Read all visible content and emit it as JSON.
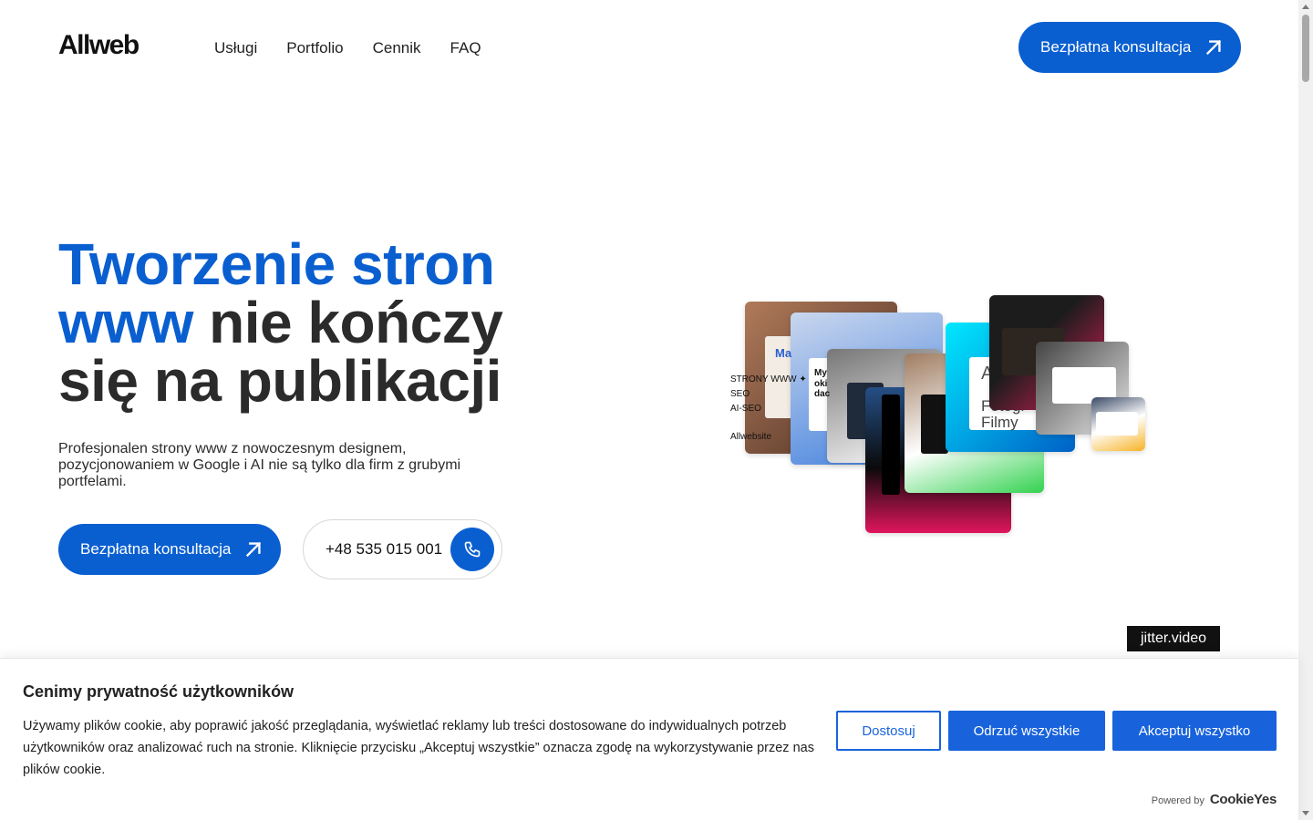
{
  "header": {
    "logo": "Allweb",
    "nav": [
      "Usługi",
      "Portfolio",
      "Cennik",
      "FAQ"
    ],
    "cta_label": "Bezpłatna konsultacja"
  },
  "hero": {
    "title_accent_1": "Tworzenie stron",
    "title_accent_2": "www",
    "title_rest_1": " nie kończy",
    "title_rest_2": "się na publikacji",
    "subtitle": "Profesjonalen strony www z nowoczesnym designem, pozycjonowaniem w Google i AI nie są tylko dla firm z grubymi portfelami.",
    "cta_label": "Bezpłatna konsultacja",
    "phone": "+48 535 015 001"
  },
  "collage": {
    "lines": [
      "STRONY WWW ✦",
      "SEO",
      "AI-SEO"
    ],
    "brand": "Allwebsite",
    "snippets": [
      "Ma",
      "My",
      "oki",
      "dac",
      "A",
      "Fotogr",
      "Filmy"
    ]
  },
  "watermark": "jitter.video",
  "cookie": {
    "title": "Cenimy prywatność użytkowników",
    "text": "Używamy plików cookie, aby poprawić jakość przeglądania, wyświetlać reklamy lub treści dostosowane do indywidualnych potrzeb użytkowników oraz analizować ruch na stronie. Kliknięcie przycisku „Akceptuj wszystkie” oznacza zgodę na wykorzystywanie przez nas plików cookie.",
    "customize": "Dostosuj",
    "reject": "Odrzuć wszystkie",
    "accept": "Akceptuj wszystko",
    "powered_by": "Powered by",
    "brand": "CookieYes"
  },
  "colors": {
    "accent": "#0a5fd0",
    "cookie_button": "#1863dc"
  }
}
